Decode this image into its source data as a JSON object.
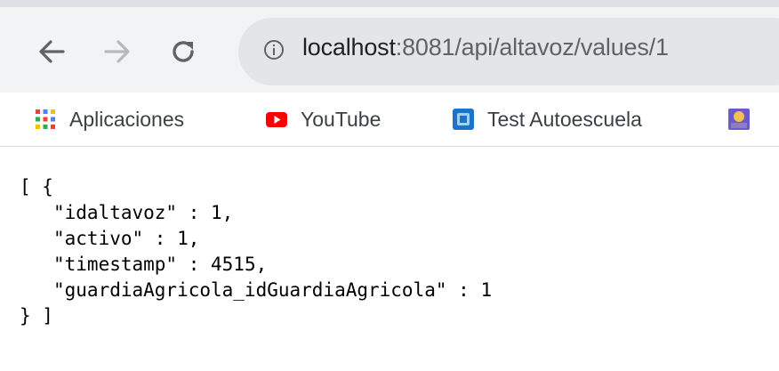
{
  "browser": {
    "url_host": "localhost",
    "url_rest": ":8081/api/altavoz/values/1"
  },
  "bookmarks": [
    {
      "label": "Aplicaciones",
      "icon": "apps-grid-icon"
    },
    {
      "label": "YouTube",
      "icon": "youtube-icon"
    },
    {
      "label": "Test Autoescuela",
      "icon": "test-autoescuela-icon"
    },
    {
      "label": "",
      "icon": "bookmark-favicon-icon"
    }
  ],
  "json_view": {
    "open": "[ {",
    "fields": [
      {
        "key": "\"idaltavoz\"",
        "sep": " : ",
        "value": "1",
        "suffix": ","
      },
      {
        "key": "\"activo\"",
        "sep": " : ",
        "value": "1",
        "suffix": ","
      },
      {
        "key": "\"timestamp\"",
        "sep": " : ",
        "value": "4515",
        "suffix": ","
      },
      {
        "key": "\"guardiaAgricola_idGuardiaAgricola\"",
        "sep": " : ",
        "value": "1",
        "suffix": ""
      }
    ],
    "close": "} ]"
  },
  "colors": {
    "toolbar_bg": "#f1f3f4",
    "omnibox_bg": "#e3e6e9",
    "youtube_red": "#ff0000",
    "test_blue": "#1e73c8"
  }
}
